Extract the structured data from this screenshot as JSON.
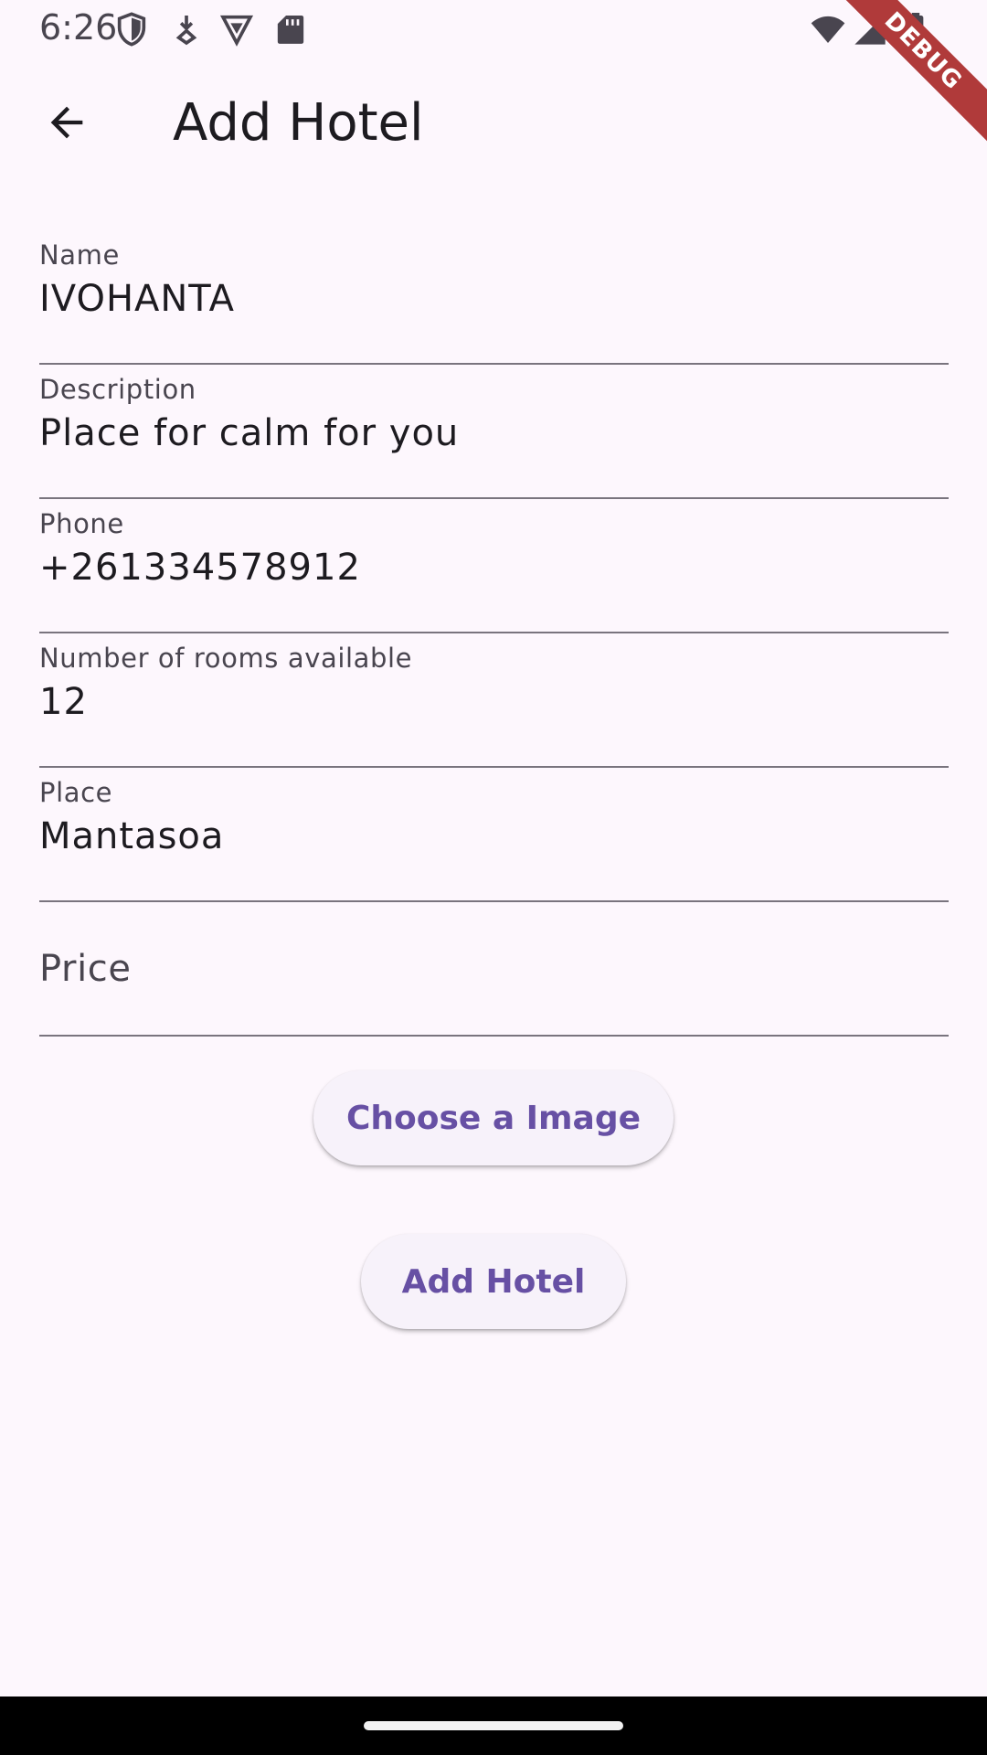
{
  "status_bar": {
    "time": "6:26",
    "left_icons": [
      "shield-icon",
      "download-icon",
      "vpn-icon",
      "sd-card-icon"
    ],
    "right_icons": [
      "wifi-icon",
      "signal-icon",
      "battery-icon"
    ]
  },
  "debug_banner": {
    "label": "DEBUG",
    "color": "#b03a3a"
  },
  "app_bar": {
    "back_icon": "arrow-back-icon",
    "title": "Add Hotel"
  },
  "form": {
    "name": {
      "label": "Name",
      "value": "IVOHANTA"
    },
    "description": {
      "label": "Description",
      "value": "Place for calm for you"
    },
    "phone": {
      "label": "Phone",
      "value": "+261334578912"
    },
    "rooms": {
      "label": "Number of rooms available",
      "value": "12"
    },
    "place": {
      "label": "Place",
      "value": "Mantasoa"
    },
    "price": {
      "label": "Price",
      "value": ""
    }
  },
  "buttons": {
    "choose_image": "Choose a Image",
    "add_hotel": "Add Hotel"
  },
  "colors": {
    "background": "#fdf7fd",
    "accent": "#6750a4",
    "underline": "#79747e"
  }
}
